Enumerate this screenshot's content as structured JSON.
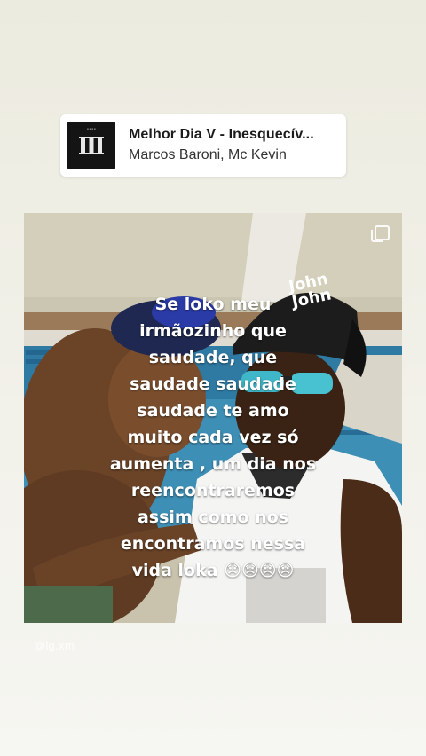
{
  "music": {
    "title": "Melhor Dia V - Inesquecív...",
    "artist": "Marcos Baroni, Mc Kevin",
    "album_icon": "roman-numeral-v-album-art"
  },
  "post": {
    "caption_lines": [
      "Se loko meu",
      "irmãozinho que",
      "saudade, que",
      "saudade saudade",
      "saudade te amo",
      "muito cada vez só",
      "aumenta , um dia nos",
      "reencontraremos",
      "assim como nos",
      "encontramos nessa",
      "vida loka 😞😞😞😞"
    ],
    "cap_text_1": "John",
    "cap_text_2": "John"
  },
  "watermark": "@lg.xm",
  "colors": {
    "background": "#efeee6",
    "card": "#ffffff",
    "caption": "#ffffff"
  }
}
